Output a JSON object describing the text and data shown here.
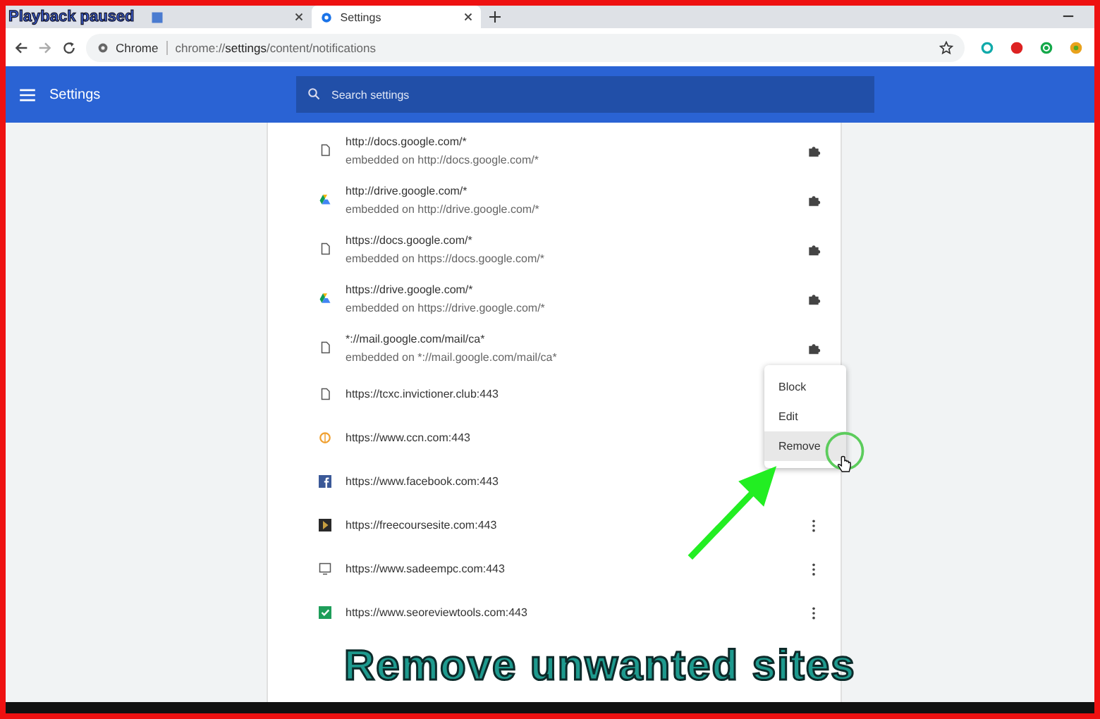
{
  "overlay_label": "Playback paused",
  "tabs": [
    {
      "selected": false
    },
    {
      "title": "Settings",
      "selected": true
    }
  ],
  "address_bar": {
    "chip": "Chrome",
    "url": "chrome://**settings**/content/notifications"
  },
  "header": {
    "title": "Settings",
    "search": {
      "placeholder": "Search settings"
    }
  },
  "sites": [
    {
      "kind": "file",
      "site": "http://docs.google.com/*",
      "embedded": "embedded on http://docs.google.com/*"
    },
    {
      "kind": "drive",
      "site": "http://drive.google.com/*",
      "embedded": "embedded on http://drive.google.com/*"
    },
    {
      "kind": "file",
      "site": "https://docs.google.com/*",
      "embedded": "embedded on https://docs.google.com/*"
    },
    {
      "kind": "drive",
      "site": "https://drive.google.com/*",
      "embedded": "embedded on https://drive.google.com/*"
    },
    {
      "kind": "file",
      "site": "*://mail.google.com/mail/ca*",
      "embedded": "embedded on *://mail.google.com/mail/ca*"
    },
    {
      "kind": "file",
      "site": "https://tcxc.invictioner.club:443",
      "more_button": false
    },
    {
      "kind": "ring",
      "site": "https://www.ccn.com:443",
      "more_button": false
    },
    {
      "kind": "facebook",
      "site": "https://www.facebook.com:443",
      "more_button": false
    },
    {
      "kind": "dark",
      "site": "https://freecoursesite.com:443",
      "more_button": true
    },
    {
      "kind": "screen",
      "site": "https://www.sadeempc.com:443",
      "more_button": true
    },
    {
      "kind": "check",
      "site": "https://www.seoreviewtools.com:443",
      "more_button": true
    }
  ],
  "menu": [
    {
      "label": "Block",
      "selected": false
    },
    {
      "label": "Edit",
      "selected": false
    },
    {
      "label": "Remove",
      "selected": true
    }
  ],
  "caption": "Remove unwanted sites"
}
